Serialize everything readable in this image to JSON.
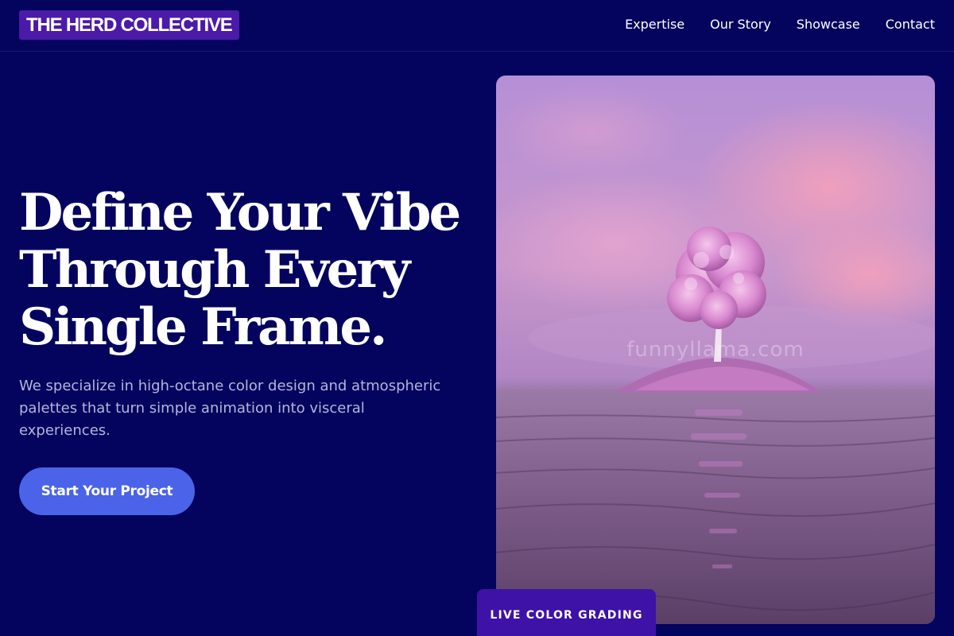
{
  "brand": {
    "logo_text": "THE HERD COLLECTIVE"
  },
  "nav": {
    "items": [
      {
        "label": "Expertise"
      },
      {
        "label": "Our Story"
      },
      {
        "label": "Showcase"
      },
      {
        "label": "Contact"
      }
    ]
  },
  "hero": {
    "headline_lines": [
      "Define Your Vibe",
      "Through Every",
      "Single Frame."
    ],
    "subtext": "We specialize in high-octane color design and atmospheric palettes that turn simple animation into visceral experiences.",
    "cta_label": "Start Your Project",
    "image_watermark": "funnyllama.com",
    "badge_label": "LIVE COLOR GRADING"
  },
  "colors": {
    "background": "#04045e",
    "logo_bg": "#4b1aa8",
    "cta_bg": "#4a63e8",
    "badge_bg": "#3e12a6",
    "subtext": "#b4b4dc"
  },
  "image_subject": "pink tree on small island in calm water under pink clouds"
}
